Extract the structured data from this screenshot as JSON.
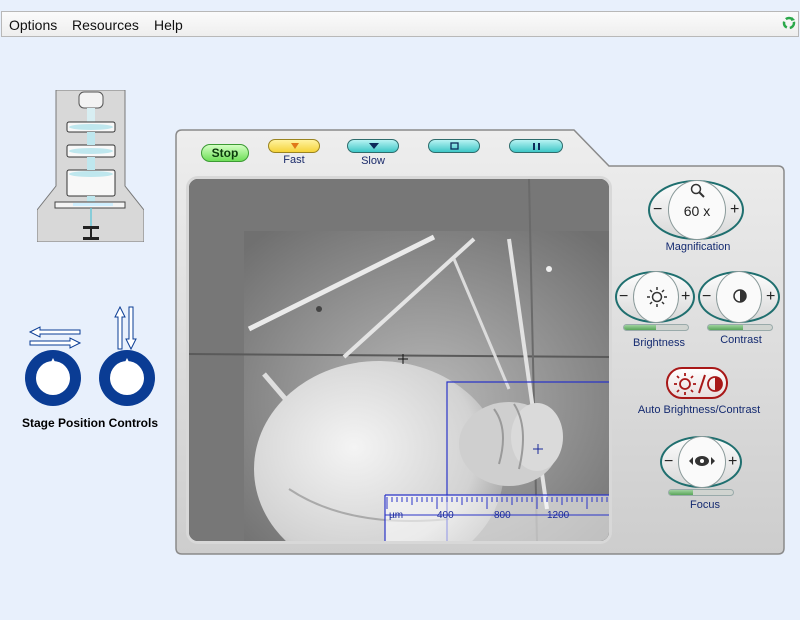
{
  "menu": {
    "options": "Options",
    "resources": "Resources",
    "help": "Help"
  },
  "stage": {
    "label": "Stage Position Controls"
  },
  "transport": {
    "stop": "Stop",
    "fast": "Fast",
    "slow": "Slow"
  },
  "viewer": {
    "scale_unit": "µm",
    "scale_ticks": [
      "400",
      "800",
      "1200"
    ]
  },
  "controls": {
    "magnification_value": "60 x",
    "magnification_label": "Magnification",
    "brightness_label": "Brightness",
    "brightness_level": 0.5,
    "contrast_label": "Contrast",
    "contrast_level": 0.55,
    "auto_label": "Auto Brightness/Contrast",
    "focus_label": "Focus",
    "focus_level": 0.38
  },
  "colors": {
    "background": "#e8f0fc",
    "accent_teal": "#1f6f6f",
    "knob_blue": "#0a3c94",
    "label_blue": "#142a70",
    "stop_green": "#6ede58",
    "fast_yellow": "#f5d33a",
    "button_cyan": "#3ec7c7",
    "auto_red": "#a81818"
  },
  "icons": [
    "recycle-icon",
    "zoom-icon",
    "sun-icon",
    "contrast-icon",
    "eye-icon",
    "stop-icon",
    "pause-icon",
    "play-down-icon"
  ]
}
